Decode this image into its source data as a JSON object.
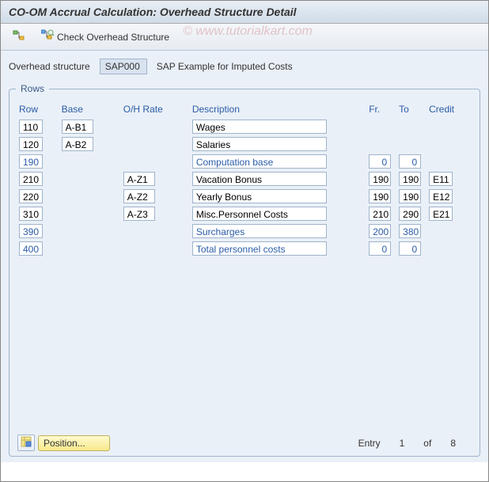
{
  "title": "CO-OM Accrual Calculation: Overhead Structure Detail",
  "toolbar": {
    "check_label": "Check Overhead Structure"
  },
  "watermark": {
    "copy": "©",
    "text": "www.tutorialkart.com"
  },
  "info": {
    "label": "Overhead structure",
    "value": "SAP000",
    "desc": "SAP Example for Imputed Costs"
  },
  "group": {
    "title": "Rows",
    "headers": {
      "row": "Row",
      "base": "Base",
      "rate": "O/H Rate",
      "desc": "Description",
      "fr": "Fr.",
      "to": "To",
      "credit": "Credit"
    },
    "rows": [
      {
        "row": "110",
        "base": "A-B1",
        "rate": "",
        "desc": "Wages",
        "fr": "",
        "to": "",
        "credit": "",
        "blue": false
      },
      {
        "row": "120",
        "base": "A-B2",
        "rate": "",
        "desc": "Salaries",
        "fr": "",
        "to": "",
        "credit": "",
        "blue": false
      },
      {
        "row": "190",
        "base": "",
        "rate": "",
        "desc": "Computation base",
        "fr": "0",
        "to": "0",
        "credit": "",
        "blue": true
      },
      {
        "row": "210",
        "base": "",
        "rate": "A-Z1",
        "desc": "Vacation Bonus",
        "fr": "190",
        "to": "190",
        "credit": "E11",
        "blue": false
      },
      {
        "row": "220",
        "base": "",
        "rate": "A-Z2",
        "desc": "Yearly Bonus",
        "fr": "190",
        "to": "190",
        "credit": "E12",
        "blue": false
      },
      {
        "row": "310",
        "base": "",
        "rate": "A-Z3",
        "desc": "Misc.Personnel Costs",
        "fr": "210",
        "to": "290",
        "credit": "E21",
        "blue": false
      },
      {
        "row": "390",
        "base": "",
        "rate": "",
        "desc": "Surcharges",
        "fr": "200",
        "to": "380",
        "credit": "",
        "blue": true
      },
      {
        "row": "400",
        "base": "",
        "rate": "",
        "desc": "Total personnel costs",
        "fr": "0",
        "to": "0",
        "credit": "",
        "blue": true
      }
    ]
  },
  "footer": {
    "position_label": "Position...",
    "entry_label": "Entry",
    "entry_from": "1",
    "of_label": "of",
    "entry_total": "8"
  }
}
